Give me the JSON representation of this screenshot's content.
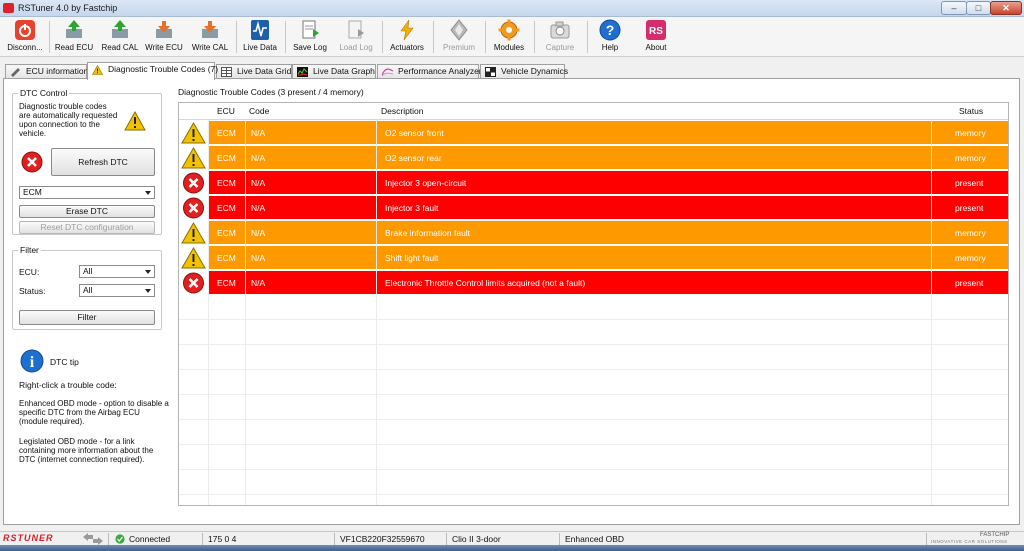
{
  "window": {
    "title": "RSTuner 4.0 by Fastchip"
  },
  "toolbar": {
    "buttons": [
      {
        "label": "Disconn...",
        "icon": "power-icon"
      },
      {
        "label": "Read ECU",
        "icon": "read-ecu-icon"
      },
      {
        "label": "Read CAL",
        "icon": "read-cal-icon"
      },
      {
        "label": "Write ECU",
        "icon": "write-ecu-icon"
      },
      {
        "label": "Write CAL",
        "icon": "write-cal-icon"
      },
      {
        "label": "Live Data",
        "icon": "live-data-icon"
      },
      {
        "label": "Save Log",
        "icon": "save-log-icon"
      },
      {
        "label": "Load Log",
        "icon": "load-log-icon"
      },
      {
        "label": "Actuators",
        "icon": "actuators-icon"
      },
      {
        "label": "Premium",
        "icon": "premium-icon"
      },
      {
        "label": "Modules",
        "icon": "modules-icon"
      },
      {
        "label": "Capture",
        "icon": "camera-icon"
      },
      {
        "label": "Help",
        "icon": "help-icon"
      },
      {
        "label": "About",
        "icon": "about-icon"
      }
    ]
  },
  "tabs": [
    {
      "label": "ECU information"
    },
    {
      "label": "Diagnostic Trouble Codes (7)"
    },
    {
      "label": "Live Data Grid"
    },
    {
      "label": "Live Data Graph"
    },
    {
      "label": "Performance Analyzer"
    },
    {
      "label": "Vehicle Dynamics"
    }
  ],
  "dtc_control": {
    "title": "DTC Control",
    "info": "Diagnostic trouble codes are automatically requested upon connection to the vehicle.",
    "refresh_label": "Refresh DTC",
    "ecu_selected": "ECM",
    "erase_label": "Erase DTC",
    "reset_label": "Reset DTC configuration"
  },
  "filter": {
    "title": "Filter",
    "ecu_label": "ECU:",
    "ecu_value": "All",
    "status_label": "Status:",
    "status_value": "All",
    "filter_button": "Filter"
  },
  "tip": {
    "title": "DTC tip",
    "line1": "Right-click a trouble code:",
    "line2": "Enhanced OBD mode - option to disable a specific DTC from the Airbag ECU (module required).",
    "line3": "Legislated OBD mode - for a link containing more information about the DTC (internet connection required)."
  },
  "dtc_list": {
    "caption": "Diagnostic Trouble Codes (3 present / 4 memory)",
    "columns": [
      "ECU",
      "Code",
      "Description",
      "Status"
    ],
    "rows": [
      {
        "ecu": "ECM",
        "code": "N/A",
        "description": "O2 sensor front",
        "status": "memory",
        "icon": "warning-icon"
      },
      {
        "ecu": "ECM",
        "code": "N/A",
        "description": "O2 sensor rear",
        "status": "memory",
        "icon": "warning-icon"
      },
      {
        "ecu": "ECM",
        "code": "N/A",
        "description": "Injector 3 open-circuit",
        "status": "present",
        "icon": "error-icon"
      },
      {
        "ecu": "ECM",
        "code": "N/A",
        "description": "Injector 3 fault",
        "status": "present",
        "icon": "error-icon"
      },
      {
        "ecu": "ECM",
        "code": "N/A",
        "description": "Brake information fault",
        "status": "memory",
        "icon": "warning-icon"
      },
      {
        "ecu": "ECM",
        "code": "N/A",
        "description": "Shift light fault",
        "status": "memory",
        "icon": "warning-icon"
      },
      {
        "ecu": "ECM",
        "code": "N/A",
        "description": "Electronic Throttle Control limits acquired (not a fault)",
        "status": "present",
        "icon": "error-icon"
      }
    ]
  },
  "colors": {
    "memory": "#ff9900",
    "present": "#ff0000",
    "brand": "#e0202c"
  },
  "statusbar": {
    "brand": "RSTUNER",
    "connection": "Connected",
    "value": "175 0 4",
    "vin": "VF1CB220F32559670",
    "model": "Clio II 3-door",
    "mode": "Enhanced OBD",
    "fastchip": "FASTCHIP",
    "fastchip_tag": "INNOVATIVE CAR SOLUTIONS"
  }
}
